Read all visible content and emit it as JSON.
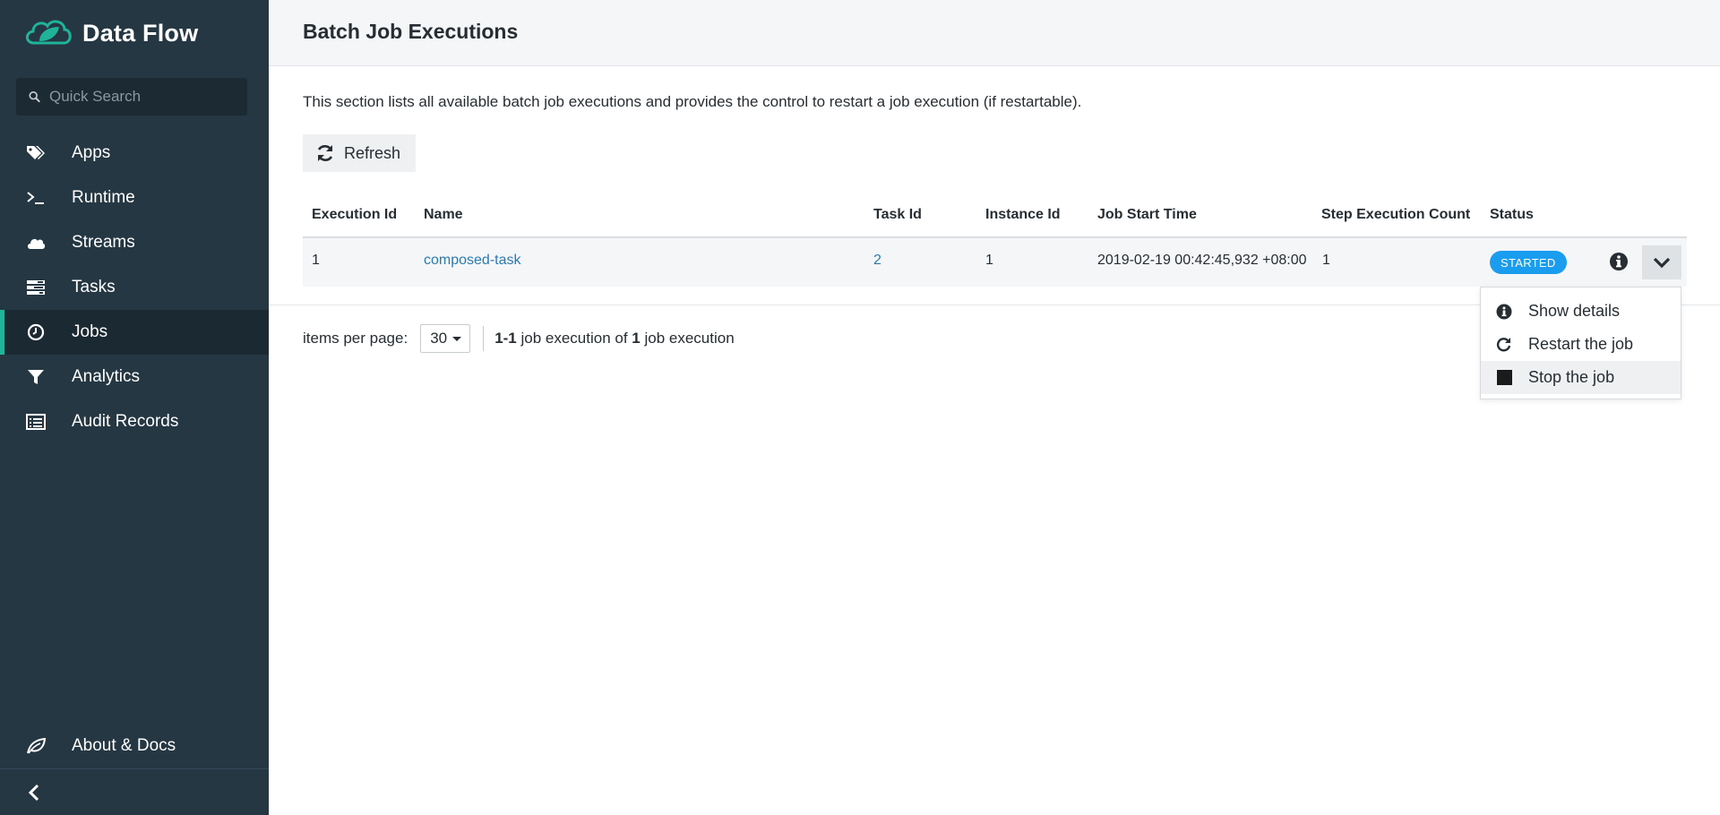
{
  "brand": {
    "title": "Data Flow"
  },
  "search": {
    "placeholder": "Quick Search"
  },
  "sidebar": {
    "items": [
      {
        "label": "Apps",
        "icon": "tags-icon"
      },
      {
        "label": "Runtime",
        "icon": "terminal-icon"
      },
      {
        "label": "Streams",
        "icon": "cloud-icon"
      },
      {
        "label": "Tasks",
        "icon": "tasks-icon"
      },
      {
        "label": "Jobs",
        "icon": "clock-icon",
        "active": true
      },
      {
        "label": "Analytics",
        "icon": "filter-icon"
      },
      {
        "label": "Audit Records",
        "icon": "list-icon"
      }
    ],
    "about_label": "About & Docs"
  },
  "page": {
    "title": "Batch Job Executions",
    "description": "This section lists all available batch job executions and provides the control to restart a job execution (if restartable).",
    "refresh_label": "Refresh"
  },
  "table": {
    "headers": [
      "Execution Id",
      "Name",
      "Task Id",
      "Instance Id",
      "Job Start Time",
      "Step Execution Count",
      "Status"
    ],
    "rows": [
      {
        "execution_id": "1",
        "name": "composed-task",
        "task_id": "2",
        "instance_id": "1",
        "start_time": "2019-02-19 00:42:45,932 +08:00",
        "step_count": "1",
        "status": "STARTED"
      }
    ]
  },
  "pager": {
    "label": "items per page:",
    "per_page": "30",
    "range": "1-1",
    "text_mid": " job execution of ",
    "total": "1",
    "text_end": " job execution"
  },
  "menu": {
    "items": [
      {
        "label": "Show details",
        "icon": "info-icon"
      },
      {
        "label": "Restart the job",
        "icon": "restart-icon"
      },
      {
        "label": "Stop the job",
        "icon": "stop-icon"
      }
    ]
  },
  "colors": {
    "sidebar": "#243743",
    "accent": "#1fb39a",
    "status_started": "#1a9cef",
    "link": "#2a7ab3"
  }
}
